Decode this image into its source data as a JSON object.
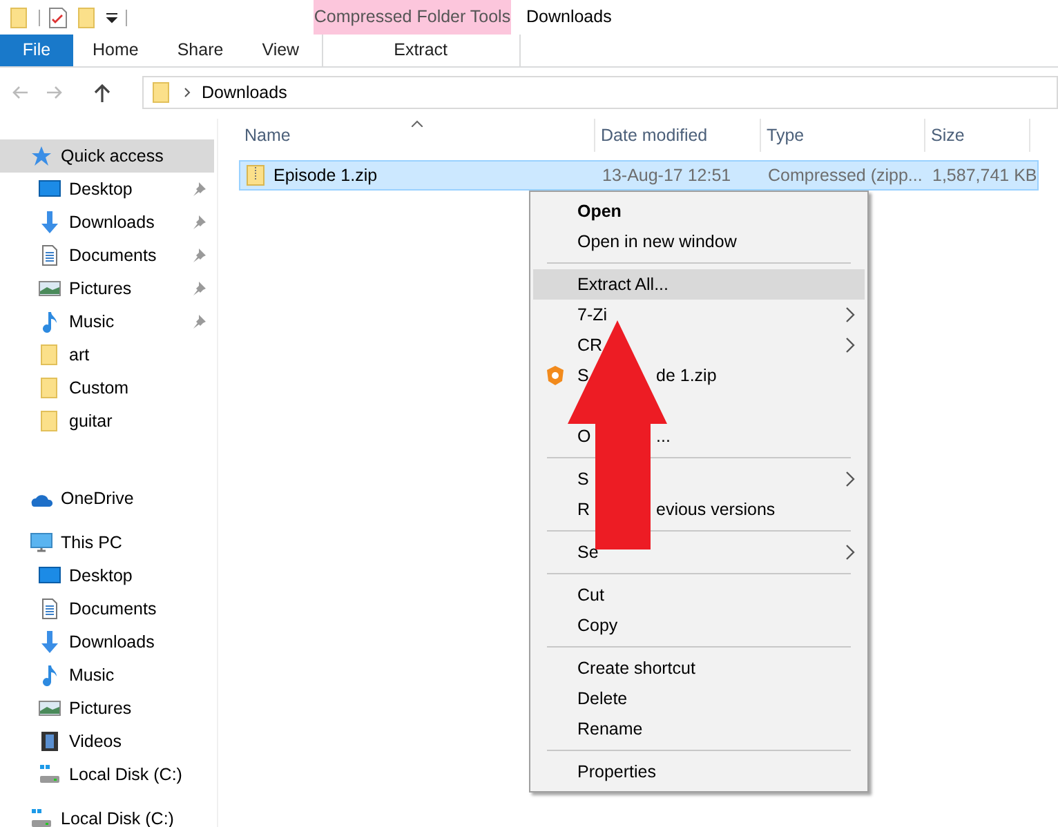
{
  "title_bar": {
    "context_tab_group": "Compressed Folder Tools",
    "title": "Downloads"
  },
  "ribbon": {
    "tabs": [
      {
        "label": "File",
        "kind": "file"
      },
      {
        "label": "Home",
        "kind": "tab"
      },
      {
        "label": "Share",
        "kind": "tab"
      },
      {
        "label": "View",
        "kind": "tab"
      },
      {
        "label": "Extract",
        "kind": "context"
      }
    ]
  },
  "address_bar": {
    "path": [
      "Downloads"
    ]
  },
  "sidebar": {
    "items": [
      {
        "label": "Quick access",
        "kind": "star",
        "selected": true,
        "children": [
          {
            "label": "Desktop",
            "kind": "desktop",
            "pinned": true,
            "selected": false
          },
          {
            "label": "Downloads",
            "kind": "download",
            "pinned": true,
            "selected": false
          },
          {
            "label": "Documents",
            "kind": "document",
            "pinned": true,
            "selected": false
          },
          {
            "label": "Pictures",
            "kind": "pictures",
            "pinned": true,
            "selected": false
          },
          {
            "label": "Music",
            "kind": "music",
            "pinned": true,
            "selected": false
          },
          {
            "label": "art",
            "kind": "folder",
            "pinned": false,
            "selected": false
          },
          {
            "label": "Custom",
            "kind": "folder",
            "pinned": false,
            "selected": false
          },
          {
            "label": "guitar",
            "kind": "folder",
            "pinned": false,
            "selected": false
          }
        ]
      },
      {
        "label": "OneDrive",
        "kind": "cloud",
        "selected": false
      },
      {
        "label": "This PC",
        "kind": "pc",
        "selected": false,
        "children": [
          {
            "label": "Desktop",
            "kind": "desktop",
            "pinned": false,
            "selected": false
          },
          {
            "label": "Documents",
            "kind": "document",
            "pinned": false,
            "selected": false
          },
          {
            "label": "Downloads",
            "kind": "download",
            "pinned": false,
            "selected": false
          },
          {
            "label": "Music",
            "kind": "music",
            "pinned": false,
            "selected": false
          },
          {
            "label": "Pictures",
            "kind": "pictures",
            "pinned": false,
            "selected": false
          },
          {
            "label": "Videos",
            "kind": "video",
            "pinned": false,
            "selected": false
          },
          {
            "label": "Local Disk (C:)",
            "kind": "drive",
            "pinned": false,
            "selected": false
          }
        ]
      },
      {
        "label": "Local Disk (C:)",
        "kind": "drive",
        "selected": false
      }
    ]
  },
  "table": {
    "columns": [
      {
        "label": "Name",
        "sorted": true
      },
      {
        "label": "Date modified",
        "sorted": false
      },
      {
        "label": "Type",
        "sorted": false
      },
      {
        "label": "Size",
        "sorted": false
      }
    ],
    "rows": [
      {
        "name": "Episode 1.zip",
        "date_modified": "13-Aug-17 12:51",
        "type": "Compressed (zipp...",
        "size": "1,587,741 KB",
        "selected": true
      }
    ]
  },
  "context_menu": {
    "items": [
      {
        "kind": "item",
        "parts": [
          "Open"
        ],
        "default": true,
        "submenu": false,
        "selected": false
      },
      {
        "kind": "item",
        "parts": [
          "Open in new window"
        ],
        "default": false,
        "submenu": false,
        "selected": false
      },
      {
        "kind": "separator"
      },
      {
        "kind": "item",
        "parts": [
          "Extract All..."
        ],
        "default": false,
        "submenu": false,
        "selected": true
      },
      {
        "kind": "item",
        "parts": [
          "7-Zi"
        ],
        "default": false,
        "submenu": true,
        "selected": false
      },
      {
        "kind": "item",
        "parts": [
          "CR"
        ],
        "default": false,
        "submenu": true,
        "selected": false
      },
      {
        "kind": "shield_item",
        "parts": [
          "S",
          "de 1.zip"
        ],
        "default": false,
        "submenu": false,
        "selected": false
      },
      {
        "kind": "covered"
      },
      {
        "kind": "item",
        "parts": [
          "O",
          "..."
        ],
        "default": false,
        "submenu": false,
        "selected": false
      },
      {
        "kind": "separator"
      },
      {
        "kind": "item",
        "parts": [
          "S"
        ],
        "default": false,
        "submenu": true,
        "selected": false
      },
      {
        "kind": "item",
        "parts": [
          "R",
          "evious versions"
        ],
        "default": false,
        "submenu": false,
        "selected": false
      },
      {
        "kind": "separator"
      },
      {
        "kind": "item",
        "parts": [
          "Se"
        ],
        "default": false,
        "submenu": true,
        "selected": false
      },
      {
        "kind": "separator"
      },
      {
        "kind": "item",
        "parts": [
          "Cut"
        ],
        "default": false,
        "submenu": false,
        "selected": false
      },
      {
        "kind": "item",
        "parts": [
          "Copy"
        ],
        "default": false,
        "submenu": false,
        "selected": false
      },
      {
        "kind": "separator"
      },
      {
        "kind": "item",
        "parts": [
          "Create shortcut"
        ],
        "default": false,
        "submenu": false,
        "selected": false
      },
      {
        "kind": "item",
        "parts": [
          "Delete"
        ],
        "default": false,
        "submenu": false,
        "selected": false
      },
      {
        "kind": "item",
        "parts": [
          "Rename"
        ],
        "default": false,
        "submenu": false,
        "selected": false
      },
      {
        "kind": "separator"
      },
      {
        "kind": "item",
        "parts": [
          "Properties"
        ],
        "default": false,
        "submenu": false,
        "selected": false
      }
    ]
  }
}
